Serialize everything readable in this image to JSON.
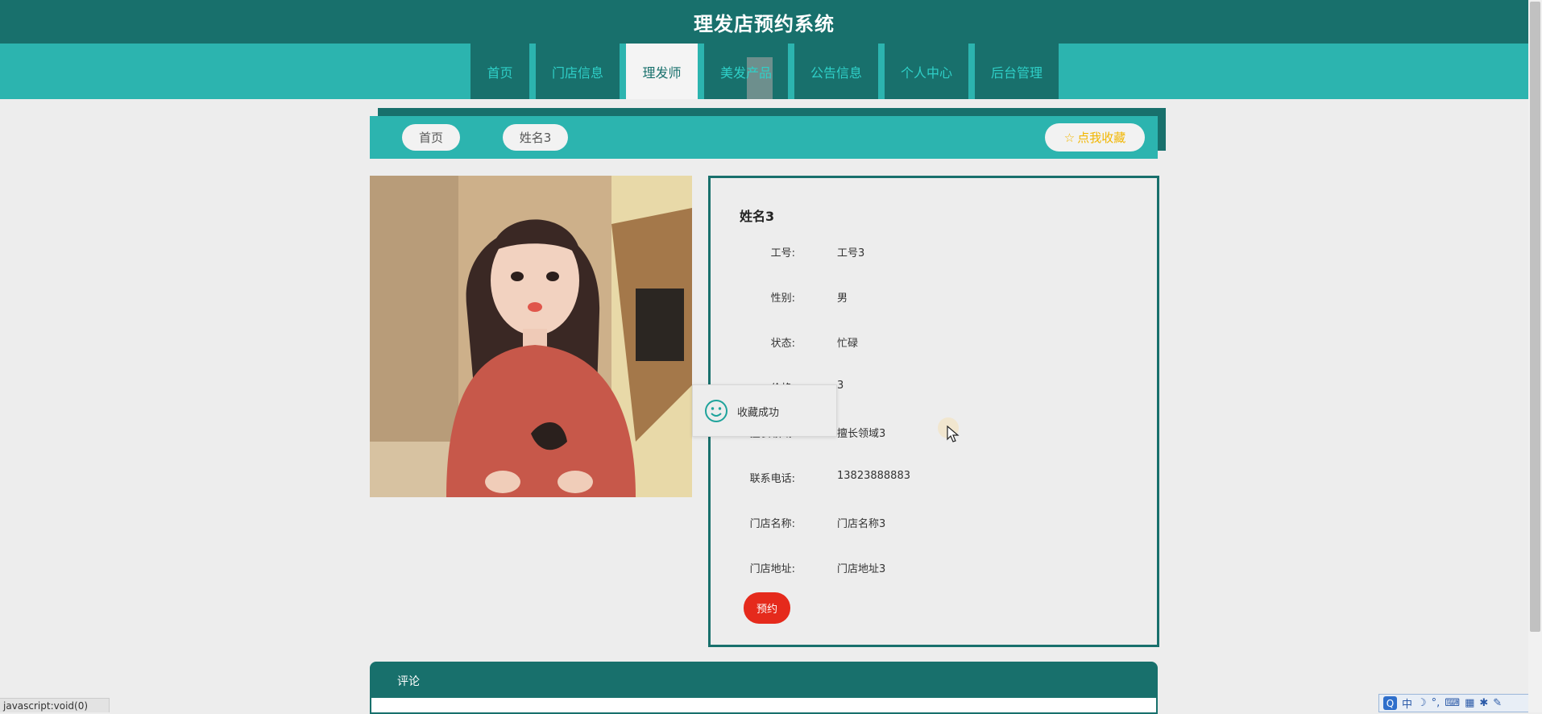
{
  "header": {
    "title": "理发店预约系统"
  },
  "nav": {
    "items": [
      {
        "label": "首页"
      },
      {
        "label": "门店信息"
      },
      {
        "label": "理发师"
      },
      {
        "label": "美发产品"
      },
      {
        "label": "公告信息"
      },
      {
        "label": "个人中心"
      },
      {
        "label": "后台管理"
      }
    ],
    "active": "理发师"
  },
  "breadcrumb": {
    "home": "首页",
    "current": "姓名3",
    "favorite_label": "点我收藏",
    "favorite_icon": "star-outline-icon"
  },
  "barber": {
    "name": "姓名3",
    "fields": [
      {
        "label": "工号:",
        "value": "工号3"
      },
      {
        "label": "性别:",
        "value": "男"
      },
      {
        "label": "状态:",
        "value": "忙碌"
      },
      {
        "label": "价格:",
        "value": "3"
      },
      {
        "label": "擅长领域:",
        "value": "擅长领域3"
      },
      {
        "label": "联系电话:",
        "value": "13823888883"
      },
      {
        "label": "门店名称:",
        "value": "门店名称3"
      },
      {
        "label": "门店地址:",
        "value": "门店地址3"
      }
    ],
    "book_label": "预约"
  },
  "toast": {
    "message": "收藏成功",
    "icon": "smile-face-icon"
  },
  "comments": {
    "title": "评论"
  },
  "statusbar": {
    "text": "javascript:void(0)"
  },
  "ime_tray": {
    "mode": "中"
  },
  "colors": {
    "primary_dark": "#18706c",
    "primary": "#2cb4af",
    "book_button": "#e52a1c",
    "favorite_text": "#f2b600"
  }
}
